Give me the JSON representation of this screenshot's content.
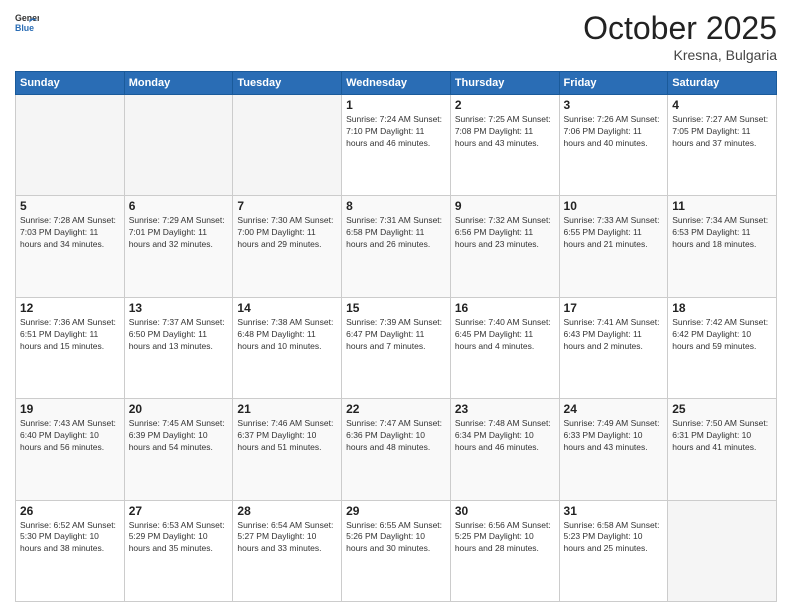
{
  "logo": {
    "general": "General",
    "blue": "Blue"
  },
  "title": {
    "month": "October 2025",
    "location": "Kresna, Bulgaria"
  },
  "weekdays": [
    "Sunday",
    "Monday",
    "Tuesday",
    "Wednesday",
    "Thursday",
    "Friday",
    "Saturday"
  ],
  "weeks": [
    [
      {
        "day": "",
        "info": ""
      },
      {
        "day": "",
        "info": ""
      },
      {
        "day": "",
        "info": ""
      },
      {
        "day": "1",
        "info": "Sunrise: 7:24 AM\nSunset: 7:10 PM\nDaylight: 11 hours\nand 46 minutes."
      },
      {
        "day": "2",
        "info": "Sunrise: 7:25 AM\nSunset: 7:08 PM\nDaylight: 11 hours\nand 43 minutes."
      },
      {
        "day": "3",
        "info": "Sunrise: 7:26 AM\nSunset: 7:06 PM\nDaylight: 11 hours\nand 40 minutes."
      },
      {
        "day": "4",
        "info": "Sunrise: 7:27 AM\nSunset: 7:05 PM\nDaylight: 11 hours\nand 37 minutes."
      }
    ],
    [
      {
        "day": "5",
        "info": "Sunrise: 7:28 AM\nSunset: 7:03 PM\nDaylight: 11 hours\nand 34 minutes."
      },
      {
        "day": "6",
        "info": "Sunrise: 7:29 AM\nSunset: 7:01 PM\nDaylight: 11 hours\nand 32 minutes."
      },
      {
        "day": "7",
        "info": "Sunrise: 7:30 AM\nSunset: 7:00 PM\nDaylight: 11 hours\nand 29 minutes."
      },
      {
        "day": "8",
        "info": "Sunrise: 7:31 AM\nSunset: 6:58 PM\nDaylight: 11 hours\nand 26 minutes."
      },
      {
        "day": "9",
        "info": "Sunrise: 7:32 AM\nSunset: 6:56 PM\nDaylight: 11 hours\nand 23 minutes."
      },
      {
        "day": "10",
        "info": "Sunrise: 7:33 AM\nSunset: 6:55 PM\nDaylight: 11 hours\nand 21 minutes."
      },
      {
        "day": "11",
        "info": "Sunrise: 7:34 AM\nSunset: 6:53 PM\nDaylight: 11 hours\nand 18 minutes."
      }
    ],
    [
      {
        "day": "12",
        "info": "Sunrise: 7:36 AM\nSunset: 6:51 PM\nDaylight: 11 hours\nand 15 minutes."
      },
      {
        "day": "13",
        "info": "Sunrise: 7:37 AM\nSunset: 6:50 PM\nDaylight: 11 hours\nand 13 minutes."
      },
      {
        "day": "14",
        "info": "Sunrise: 7:38 AM\nSunset: 6:48 PM\nDaylight: 11 hours\nand 10 minutes."
      },
      {
        "day": "15",
        "info": "Sunrise: 7:39 AM\nSunset: 6:47 PM\nDaylight: 11 hours\nand 7 minutes."
      },
      {
        "day": "16",
        "info": "Sunrise: 7:40 AM\nSunset: 6:45 PM\nDaylight: 11 hours\nand 4 minutes."
      },
      {
        "day": "17",
        "info": "Sunrise: 7:41 AM\nSunset: 6:43 PM\nDaylight: 11 hours\nand 2 minutes."
      },
      {
        "day": "18",
        "info": "Sunrise: 7:42 AM\nSunset: 6:42 PM\nDaylight: 10 hours\nand 59 minutes."
      }
    ],
    [
      {
        "day": "19",
        "info": "Sunrise: 7:43 AM\nSunset: 6:40 PM\nDaylight: 10 hours\nand 56 minutes."
      },
      {
        "day": "20",
        "info": "Sunrise: 7:45 AM\nSunset: 6:39 PM\nDaylight: 10 hours\nand 54 minutes."
      },
      {
        "day": "21",
        "info": "Sunrise: 7:46 AM\nSunset: 6:37 PM\nDaylight: 10 hours\nand 51 minutes."
      },
      {
        "day": "22",
        "info": "Sunrise: 7:47 AM\nSunset: 6:36 PM\nDaylight: 10 hours\nand 48 minutes."
      },
      {
        "day": "23",
        "info": "Sunrise: 7:48 AM\nSunset: 6:34 PM\nDaylight: 10 hours\nand 46 minutes."
      },
      {
        "day": "24",
        "info": "Sunrise: 7:49 AM\nSunset: 6:33 PM\nDaylight: 10 hours\nand 43 minutes."
      },
      {
        "day": "25",
        "info": "Sunrise: 7:50 AM\nSunset: 6:31 PM\nDaylight: 10 hours\nand 41 minutes."
      }
    ],
    [
      {
        "day": "26",
        "info": "Sunrise: 6:52 AM\nSunset: 5:30 PM\nDaylight: 10 hours\nand 38 minutes."
      },
      {
        "day": "27",
        "info": "Sunrise: 6:53 AM\nSunset: 5:29 PM\nDaylight: 10 hours\nand 35 minutes."
      },
      {
        "day": "28",
        "info": "Sunrise: 6:54 AM\nSunset: 5:27 PM\nDaylight: 10 hours\nand 33 minutes."
      },
      {
        "day": "29",
        "info": "Sunrise: 6:55 AM\nSunset: 5:26 PM\nDaylight: 10 hours\nand 30 minutes."
      },
      {
        "day": "30",
        "info": "Sunrise: 6:56 AM\nSunset: 5:25 PM\nDaylight: 10 hours\nand 28 minutes."
      },
      {
        "day": "31",
        "info": "Sunrise: 6:58 AM\nSunset: 5:23 PM\nDaylight: 10 hours\nand 25 minutes."
      },
      {
        "day": "",
        "info": ""
      }
    ]
  ]
}
